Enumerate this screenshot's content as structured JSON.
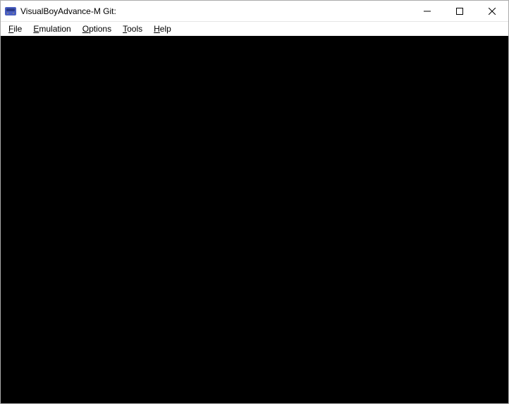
{
  "window": {
    "title": "VisualBoyAdvance-M Git:"
  },
  "menu": {
    "file": "File",
    "emulation": "Emulation",
    "options": "Options",
    "tools": "Tools",
    "help": "Help"
  }
}
